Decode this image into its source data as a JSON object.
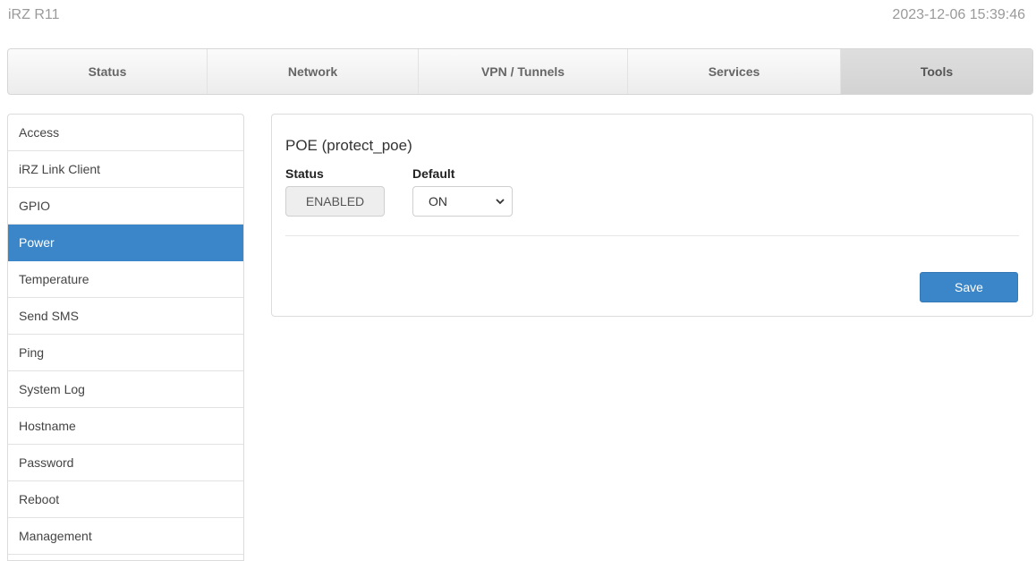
{
  "header": {
    "brand": "iRZ R11",
    "datetime": "2023-12-06 15:39:46"
  },
  "nav": {
    "tabs": [
      {
        "label": "Status"
      },
      {
        "label": "Network"
      },
      {
        "label": "VPN / Tunnels"
      },
      {
        "label": "Services"
      },
      {
        "label": "Tools",
        "active": true
      }
    ]
  },
  "sidebar": {
    "items": [
      {
        "label": "Access"
      },
      {
        "label": "iRZ Link Client"
      },
      {
        "label": "GPIO"
      },
      {
        "label": "Power",
        "active": true
      },
      {
        "label": "Temperature"
      },
      {
        "label": "Send SMS"
      },
      {
        "label": "Ping"
      },
      {
        "label": "System Log"
      },
      {
        "label": "Hostname"
      },
      {
        "label": "Password"
      },
      {
        "label": "Reboot"
      },
      {
        "label": "Management"
      }
    ]
  },
  "panel": {
    "title": "POE (protect_poe)",
    "status_label": "Status",
    "status_value": "ENABLED",
    "default_label": "Default",
    "default_value": "ON",
    "save_label": "Save"
  },
  "colors": {
    "accent": "#3a86c8"
  }
}
